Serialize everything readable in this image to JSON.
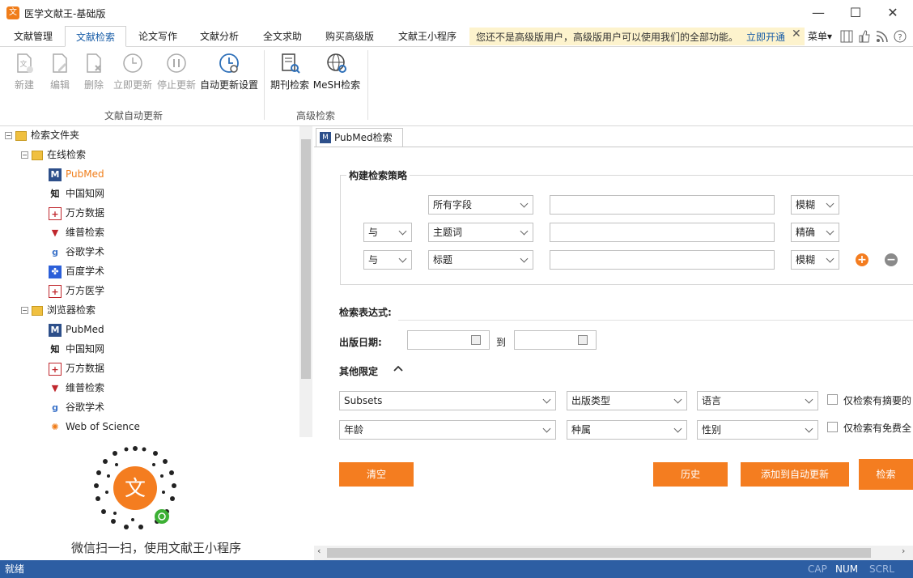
{
  "window": {
    "title": "医学文献王-基础版",
    "minimize": "—",
    "maximize": "☐",
    "close": "✕"
  },
  "menu": {
    "tabs": [
      "文献管理",
      "文献检索",
      "论文写作",
      "文献分析",
      "全文求助",
      "购买高级版",
      "文献王小程序"
    ],
    "active_tab": "文献检索",
    "promo_text": "您还不是高级版用户，高级版用户可以使用我们的全部功能。",
    "promo_link": "立即开通",
    "promo_close": "✕",
    "menu_label": "菜单▾"
  },
  "ribbon": {
    "groups": [
      {
        "label": "文献自动更新",
        "buttons": [
          {
            "label": "新建",
            "icon": "new-doc-icon",
            "enabled": false
          },
          {
            "label": "编辑",
            "icon": "edit-doc-icon",
            "enabled": false
          },
          {
            "label": "删除",
            "icon": "delete-doc-icon",
            "enabled": false
          },
          {
            "label": "立即更新",
            "icon": "refresh-clock-icon",
            "enabled": false
          },
          {
            "label": "停止更新",
            "icon": "pause-clock-icon",
            "enabled": false
          },
          {
            "label": "自动更新设置",
            "icon": "clock-gear-icon",
            "enabled": true
          }
        ]
      },
      {
        "label": "高级检索",
        "buttons": [
          {
            "label": "期刊检索",
            "icon": "journal-search-icon",
            "enabled": true
          },
          {
            "label": "MeSH检索",
            "icon": "globe-search-icon",
            "enabled": true
          }
        ]
      }
    ]
  },
  "tree": {
    "root": "检索文件夹",
    "groups": [
      {
        "label": "在线检索",
        "items": [
          {
            "label": "PubMed",
            "icon": "pubmed-icon",
            "selected": true
          },
          {
            "label": "中国知网",
            "icon": "cnki-icon"
          },
          {
            "label": "万方数据",
            "icon": "wanfang-icon"
          },
          {
            "label": "维普检索",
            "icon": "vip-icon"
          },
          {
            "label": "谷歌学术",
            "icon": "google-scholar-icon"
          },
          {
            "label": "百度学术",
            "icon": "baidu-scholar-icon"
          },
          {
            "label": "万方医学",
            "icon": "wanfang-med-icon"
          }
        ]
      },
      {
        "label": "浏览器检索",
        "items": [
          {
            "label": "PubMed",
            "icon": "pubmed-icon"
          },
          {
            "label": "中国知网",
            "icon": "cnki-icon"
          },
          {
            "label": "万方数据",
            "icon": "wanfang-icon"
          },
          {
            "label": "维普检索",
            "icon": "vip-icon"
          },
          {
            "label": "谷歌学术",
            "icon": "google-scholar-icon"
          },
          {
            "label": "Web of Science",
            "icon": "wos-icon"
          }
        ]
      }
    ]
  },
  "qr_caption": "微信扫一扫，使用文献王小程序",
  "doc_tab": "PubMed检索",
  "search": {
    "strategy_title": "构建检索策略",
    "rows": [
      {
        "op": "",
        "field": "所有字段",
        "value": "",
        "match": "模糊"
      },
      {
        "op": "与",
        "field": "主题词",
        "value": "",
        "match": "精确"
      },
      {
        "op": "与",
        "field": "标题",
        "value": "",
        "match": "模糊"
      }
    ],
    "add_symbol": "+",
    "remove_symbol": "−",
    "expression_label": "检索表达式:",
    "date_label": "出版日期:",
    "date_to": "到",
    "other_label": "其他限定",
    "other_toggle": "^",
    "filters": [
      [
        "Subsets",
        "出版类型",
        "语言"
      ],
      [
        "年龄",
        "种属",
        "性别"
      ]
    ],
    "checkbox_abstract": "仅检索有摘要的",
    "checkbox_free": "仅检索有免费全",
    "btn_clear": "清空",
    "btn_history": "历史",
    "btn_add_auto": "添加到自动更新",
    "btn_search": "检索"
  },
  "status": {
    "left": "就绪",
    "cap": "CAP",
    "num": "NUM",
    "scrl": "SCRL"
  },
  "colors": {
    "accent": "#f47d20",
    "status_bar": "#2d5ea3",
    "link": "#1a5ea8",
    "promo_bg": "#fdf3cd"
  }
}
